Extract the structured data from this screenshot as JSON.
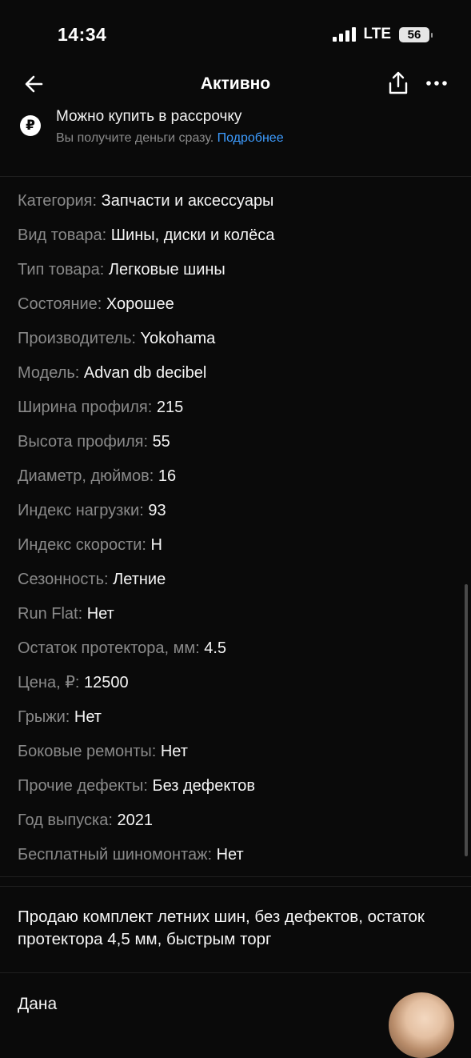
{
  "status_bar": {
    "time": "14:34",
    "network": "LTE",
    "battery": "56"
  },
  "nav": {
    "title": "Активно",
    "back_icon": "arrow-left-icon",
    "share_icon": "share-icon",
    "more_icon": "more-horizontal-icon"
  },
  "installment": {
    "icon": "ruble-icon",
    "icon_glyph": "₽",
    "title": "Можно купить в рассрочку",
    "subtitle": "Вы получите деньги сразу.",
    "link": "Подробнее"
  },
  "params": [
    {
      "label": "Категория:",
      "value": "Запчасти и аксессуары"
    },
    {
      "label": "Вид товара:",
      "value": "Шины, диски и колёса"
    },
    {
      "label": "Тип товара:",
      "value": "Легковые шины"
    },
    {
      "label": "Состояние:",
      "value": "Хорошее"
    },
    {
      "label": "Производитель:",
      "value": "Yokohama"
    },
    {
      "label": "Модель:",
      "value": "Advan db decibel"
    },
    {
      "label": "Ширина профиля:",
      "value": "215"
    },
    {
      "label": "Высота профиля:",
      "value": "55"
    },
    {
      "label": "Диаметр, дюймов:",
      "value": "16"
    },
    {
      "label": "Индекс нагрузки:",
      "value": "93"
    },
    {
      "label": "Индекс скорости:",
      "value": "H"
    },
    {
      "label": "Сезонность:",
      "value": "Летние"
    },
    {
      "label": "Run Flat:",
      "value": "Нет"
    },
    {
      "label": "Остаток протектора, мм:",
      "value": "4.5"
    },
    {
      "label": "Цена, ₽:",
      "value": "12500"
    },
    {
      "label": "Грыжи:",
      "value": "Нет"
    },
    {
      "label": "Боковые ремонты:",
      "value": "Нет"
    },
    {
      "label": "Прочие дефекты:",
      "value": "Без дефектов"
    },
    {
      "label": "Год выпуска:",
      "value": "2021"
    },
    {
      "label": "Бесплатный шиномонтаж:",
      "value": "Нет"
    }
  ],
  "description": "Продаю комплект летних шин, без дефектов, остаток протектора 4,5 мм, быстрым торг",
  "seller": {
    "name": "Дана"
  },
  "colors": {
    "background": "#0a0a0a",
    "label": "#8a8a8a",
    "link": "#3d9cff"
  }
}
